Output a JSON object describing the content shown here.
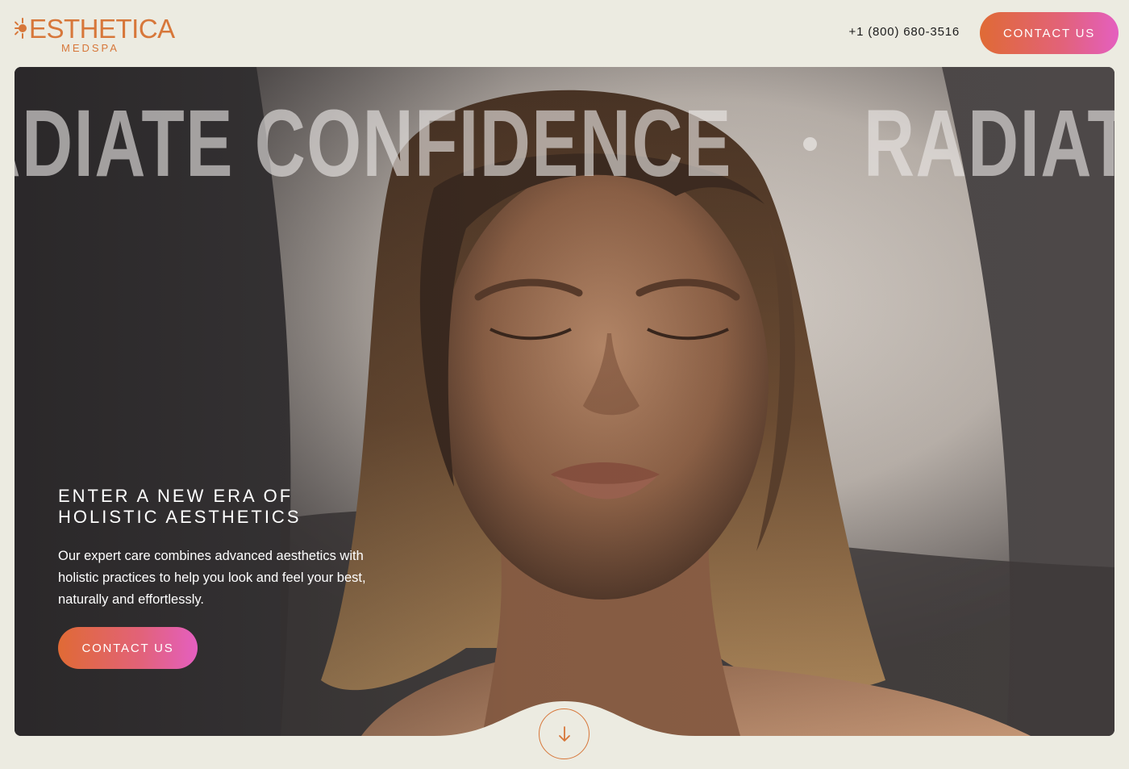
{
  "header": {
    "logo_word": "ESTHETICA",
    "logo_sub": "MEDSPA",
    "phone": "+1 (800) 680-3516",
    "cta_label": "CONTACT US"
  },
  "hero": {
    "marquee_text": "RADIATE CONFIDENCE",
    "title_line1": "ENTER A NEW ERA OF",
    "title_line2": "HOLISTIC AESTHETICS",
    "description": "Our expert care combines advanced aesthetics with holistic practices to help you look and feel your best, naturally and effortlessly.",
    "cta_label": "CONTACT US",
    "scroll_icon": "arrow-down-icon"
  },
  "colors": {
    "background": "#ecebe1",
    "brand_orange": "#d7773a",
    "gradient_start": "#e06a35",
    "gradient_end": "#e45fc0"
  }
}
